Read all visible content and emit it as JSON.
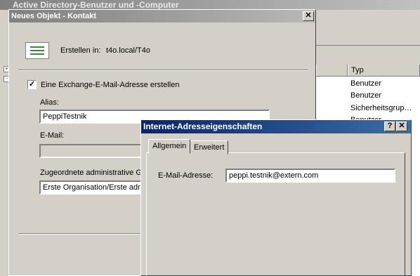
{
  "background_window": {
    "title": "Active Directory-Benutzer und -Computer",
    "list": {
      "column_type": "Typ",
      "rows": [
        "Benutzer",
        "Benutzer",
        "Sicherheitsgrup…",
        "Benutzer"
      ]
    },
    "tree_expanders": [
      "+",
      "-"
    ]
  },
  "dialog_contact": {
    "title": "Neues Objekt - Kontakt",
    "close_glyph": "✕",
    "created_in_label": "Erstellen in:",
    "created_in_value": "t4o.local/T4o",
    "exchange_checkbox": {
      "checked": true,
      "glyph": "✓",
      "label": "Eine Exchange-E-Mail-Adresse erstellen"
    },
    "alias": {
      "label": "Alias:",
      "value": "PeppiTestnik"
    },
    "email": {
      "label": "E-Mail:",
      "value": ""
    },
    "admin_group": {
      "label": "Zugeordnete administrative Gru",
      "value": "Erste Organisation/Erste admi"
    }
  },
  "dialog_internet": {
    "title": "Internet-Adresseigenschaften",
    "help_glyph": "?",
    "close_glyph": "✕",
    "tabs": [
      "Allgemein",
      "Erweitert"
    ],
    "active_tab": "Allgemein",
    "email_field": {
      "label": "E-Mail-Adresse:",
      "value": "peppi.testnik@extern.com"
    }
  }
}
